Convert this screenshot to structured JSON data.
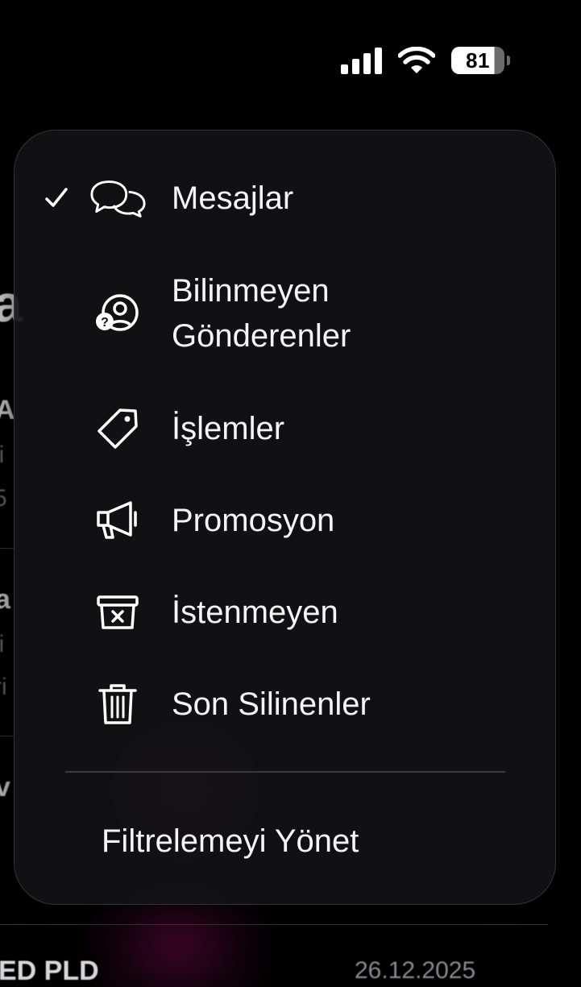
{
  "status_bar": {
    "battery_level": "81",
    "battery_fraction": 0.81
  },
  "menu": {
    "items": [
      {
        "label": "Mesajlar",
        "icon": "messages-bubbles-icon",
        "selected": true
      },
      {
        "label_line1": "Bilinmeyen",
        "label_line2": "Gönderenler",
        "icon": "unknown-person-icon",
        "selected": false
      },
      {
        "label": "İşlemler",
        "icon": "tag-icon",
        "selected": false
      },
      {
        "label": "Promosyon",
        "icon": "megaphone-icon",
        "selected": false
      },
      {
        "label": "İstenmeyen",
        "icon": "junk-bin-icon",
        "selected": false
      },
      {
        "label": "Son Silinenler",
        "icon": "trash-icon",
        "selected": false
      }
    ],
    "manage_label": "Filtrelemeyi Yönet"
  },
  "background": {
    "fragments": [
      "a",
      "A",
      "li",
      "5",
      "a",
      "li",
      "ri",
      "v",
      "ED PLD",
      "26.12.2025"
    ]
  },
  "colors": {
    "menu_bg": "#121214",
    "text": "#f5f5f7",
    "separator": "#3a3a3c"
  }
}
